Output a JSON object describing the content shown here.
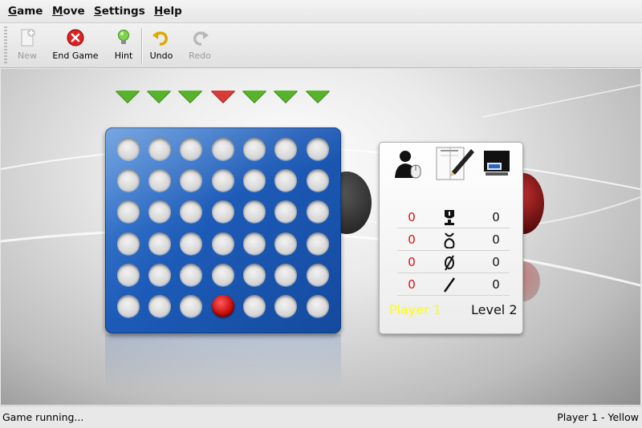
{
  "menu": {
    "game": {
      "accel": "G",
      "rest": "ame"
    },
    "move": {
      "accel": "M",
      "rest": "ove"
    },
    "settings": {
      "accel": "S",
      "rest": "ettings"
    },
    "help": {
      "accel": "H",
      "rest": "elp"
    }
  },
  "toolbar": {
    "new_label": "New",
    "end_game_label": "End Game",
    "hint_label": "Hint",
    "undo_label": "Undo",
    "redo_label": "Redo"
  },
  "board": {
    "columns": 7,
    "rows": 6,
    "active_column": 4,
    "pieces": [
      {
        "row": 6,
        "col": 4,
        "color": "red"
      }
    ]
  },
  "scoreboard": {
    "icons": [
      "human-player-icon",
      "notepad-pencil-icon",
      "computer-player-icon"
    ],
    "rows": [
      {
        "icon": "win-trophy-icon",
        "left": "0",
        "right": "0"
      },
      {
        "icon": "loss-knot-icon",
        "left": "0",
        "right": "0"
      },
      {
        "icon": "draw-zero-icon",
        "left": "0",
        "right": "0"
      },
      {
        "icon": "aborted-slash-icon",
        "left": "0",
        "right": "0"
      }
    ],
    "left_player": "Player 1",
    "right_player": "Level 2"
  },
  "colors": {
    "player1": "#ffff00",
    "board_blue": "#1d5bb8",
    "arrow_green": "#57b32a",
    "arrow_red": "#d83a3a",
    "score_red": "#e01010"
  },
  "status": {
    "left": "Game running...",
    "right": "Player 1 - Yellow"
  }
}
